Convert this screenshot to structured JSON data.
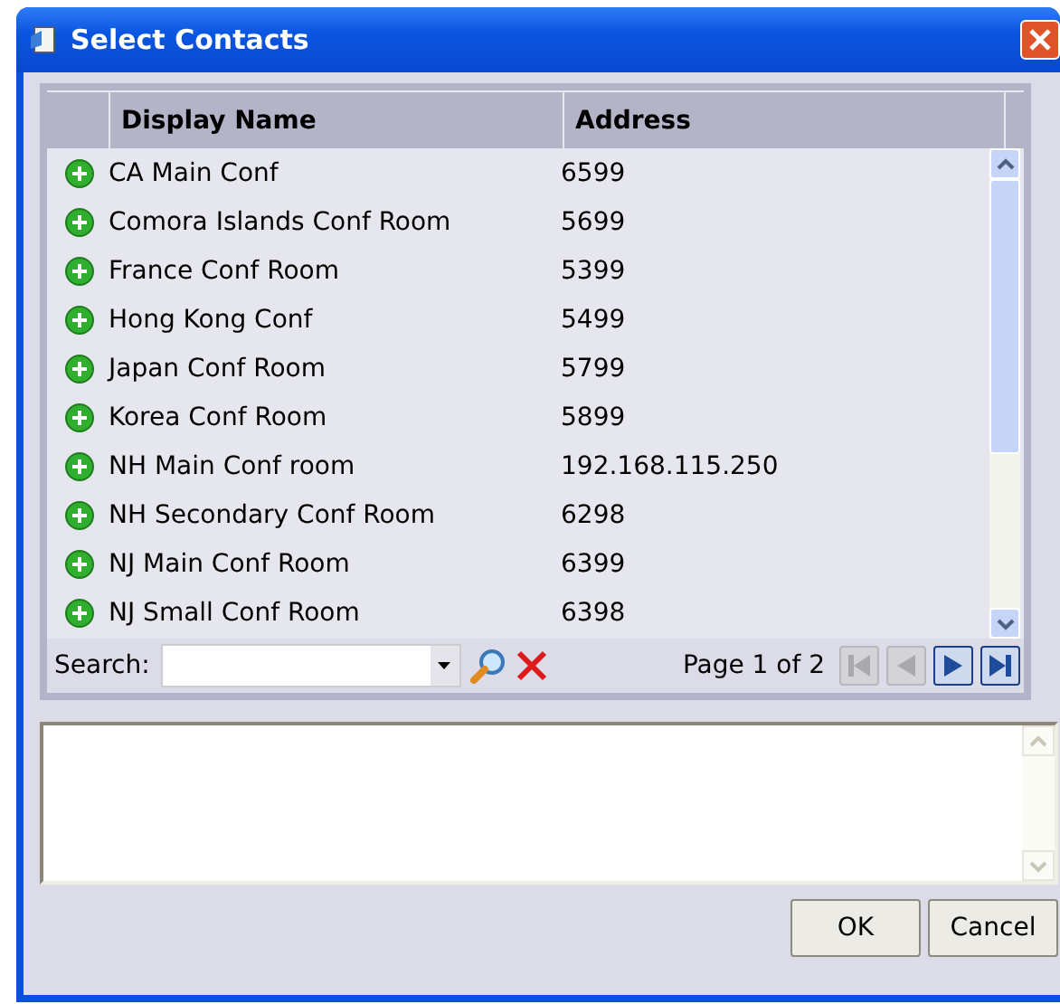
{
  "window": {
    "title": "Select Contacts"
  },
  "table": {
    "columns": [
      "Display Name",
      "Address"
    ],
    "rows": [
      {
        "name": "CA Main Conf",
        "address": "6599"
      },
      {
        "name": "Comora Islands Conf Room",
        "address": "5699"
      },
      {
        "name": "France Conf Room",
        "address": "5399"
      },
      {
        "name": "Hong Kong Conf",
        "address": "5499"
      },
      {
        "name": "Japan Conf Room",
        "address": "5799"
      },
      {
        "name": "Korea Conf Room",
        "address": "5899"
      },
      {
        "name": "NH Main Conf room",
        "address": "192.168.115.250"
      },
      {
        "name": "NH Secondary Conf Room",
        "address": "6298"
      },
      {
        "name": "NJ Main Conf Room",
        "address": "6399"
      },
      {
        "name": "NJ Small Conf Room",
        "address": "6398"
      }
    ]
  },
  "search": {
    "label": "Search:"
  },
  "pager": {
    "text": "Page 1 of 2",
    "buttons": [
      {
        "kind": "first",
        "disabled": true
      },
      {
        "kind": "prev",
        "disabled": true
      },
      {
        "kind": "next",
        "disabled": false
      },
      {
        "kind": "last",
        "disabled": false
      }
    ]
  },
  "buttons": [
    "OK",
    "Cancel"
  ]
}
